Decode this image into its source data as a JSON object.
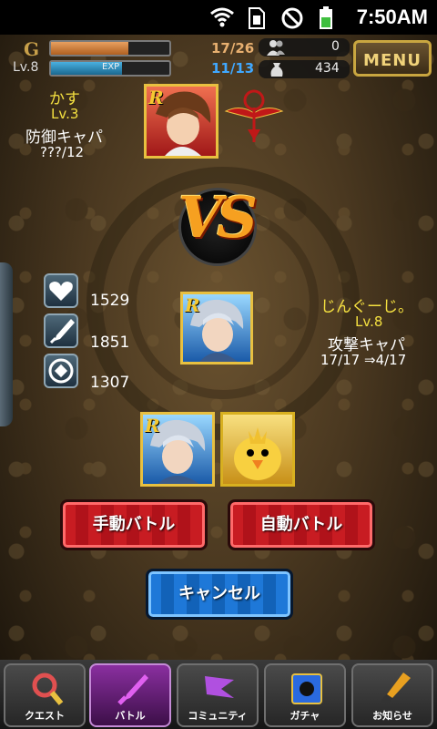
{
  "status_bar": {
    "time": "7:50AM"
  },
  "hud": {
    "gold_icon": "G",
    "level": "Lv.8",
    "stamina": "17/26",
    "stamina_fraction": 0.65,
    "exp_label": "EXP",
    "battle_points": "11/13",
    "bp_fraction": 0.85,
    "friends_count": "0",
    "money": "434",
    "menu_label": "MENU"
  },
  "opponent": {
    "name": "かす",
    "level": "Lv.3",
    "type": "防御キャパ",
    "capacity": "???/12",
    "card_rarity": "R",
    "colors": {
      "name": "#f0e040"
    }
  },
  "vs_label": "VS",
  "player": {
    "name": "じんぐーじ。",
    "level": "Lv.8",
    "type": "攻撃キャパ",
    "capacity": "17/17 ⇒4/17",
    "card_rarity": "R"
  },
  "stats": {
    "hp": "1529",
    "attack": "1851",
    "defense": "1307"
  },
  "deck": [
    {
      "rarity": "R",
      "kind": "swordsman"
    },
    {
      "rarity": "",
      "kind": "chick"
    }
  ],
  "buttons": {
    "manual": "手動バトル",
    "auto": "自動バトル",
    "cancel": "キャンセル"
  },
  "nav": [
    {
      "label": "クエスト",
      "icon": "magnifier-icon",
      "active": false
    },
    {
      "label": "バトル",
      "icon": "sword-icon",
      "active": true
    },
    {
      "label": "コミュニティ",
      "icon": "flag-icon",
      "active": false
    },
    {
      "label": "ガチャ",
      "icon": "gacha-icon",
      "active": false
    },
    {
      "label": "お知らせ",
      "icon": "brush-icon",
      "active": false
    }
  ]
}
